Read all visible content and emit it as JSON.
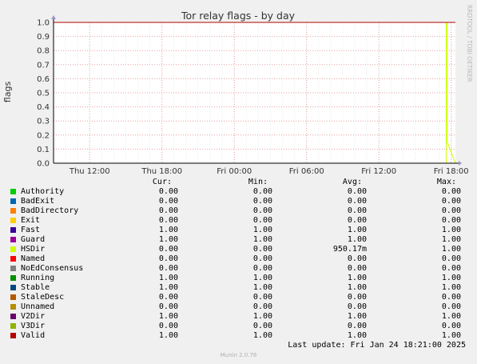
{
  "chart_data": {
    "type": "line",
    "title": "Tor relay flags - by day",
    "ylabel": "flags",
    "xlabel": "",
    "ylim": [
      0,
      1
    ],
    "y_ticks": [
      "0.0",
      "0.1",
      "0.2",
      "0.3",
      "0.4",
      "0.5",
      "0.6",
      "0.7",
      "0.8",
      "0.9",
      "1.0"
    ],
    "x_ticks": [
      "Thu 12:00",
      "Thu 18:00",
      "Fri 00:00",
      "Fri 06:00",
      "Fri 12:00",
      "Fri 18:00"
    ],
    "grid": true,
    "series": [
      {
        "name": "Authority",
        "color": "#00cc00",
        "x": [
          "Thu 09:00",
          "Fri 18:21"
        ],
        "y": [
          0,
          0
        ]
      },
      {
        "name": "BadExit",
        "color": "#0066b3",
        "x": [
          "Thu 09:00",
          "Fri 18:21"
        ],
        "y": [
          0,
          0
        ]
      },
      {
        "name": "BadDirectory",
        "color": "#ff8000",
        "x": [
          "Thu 09:00",
          "Fri 18:21"
        ],
        "y": [
          0,
          0
        ]
      },
      {
        "name": "Exit",
        "color": "#ffcc00",
        "x": [
          "Thu 09:00",
          "Fri 18:21"
        ],
        "y": [
          0,
          0
        ]
      },
      {
        "name": "Fast",
        "color": "#330099",
        "x": [
          "Thu 09:00",
          "Fri 18:21"
        ],
        "y": [
          1,
          1
        ]
      },
      {
        "name": "Guard",
        "color": "#990099",
        "x": [
          "Thu 09:00",
          "Fri 18:21"
        ],
        "y": [
          1,
          1
        ]
      },
      {
        "name": "HSDir",
        "color": "#ccff00",
        "x": [
          "Thu 09:00",
          "Fri 16:00",
          "Fri 17:35",
          "Fri 17:35",
          "Fri 17:40",
          "Fri 17:40",
          "Fri 18:21"
        ],
        "y": [
          0,
          0,
          0,
          1,
          1,
          0.15,
          0
        ]
      },
      {
        "name": "Named",
        "color": "#ff0000",
        "x": [
          "Thu 09:00",
          "Fri 18:21"
        ],
        "y": [
          0,
          0
        ]
      },
      {
        "name": "NoEdConsensus",
        "color": "#808080",
        "x": [
          "Thu 09:00",
          "Fri 18:21"
        ],
        "y": [
          0,
          0
        ]
      },
      {
        "name": "Running",
        "color": "#008f00",
        "x": [
          "Thu 09:00",
          "Fri 18:21"
        ],
        "y": [
          1,
          1
        ]
      },
      {
        "name": "Stable",
        "color": "#00487d",
        "x": [
          "Thu 09:00",
          "Fri 18:21"
        ],
        "y": [
          1,
          1
        ]
      },
      {
        "name": "StaleDesc",
        "color": "#b35a00",
        "x": [
          "Thu 09:00",
          "Fri 18:21"
        ],
        "y": [
          0,
          0
        ]
      },
      {
        "name": "Unnamed",
        "color": "#b38f00",
        "x": [
          "Thu 09:00",
          "Fri 18:21"
        ],
        "y": [
          0,
          0
        ]
      },
      {
        "name": "V2Dir",
        "color": "#6b006b",
        "x": [
          "Thu 09:00",
          "Fri 18:21"
        ],
        "y": [
          1,
          1
        ]
      },
      {
        "name": "V3Dir",
        "color": "#8fb300",
        "x": [
          "Thu 09:00",
          "Fri 18:21"
        ],
        "y": [
          0,
          0
        ]
      },
      {
        "name": "Valid",
        "color": "#b30000",
        "x": [
          "Thu 09:00",
          "Fri 18:21"
        ],
        "y": [
          1,
          1
        ]
      }
    ]
  },
  "legend": {
    "headers": {
      "cur": "Cur:",
      "min": "Min:",
      "avg": "Avg:",
      "max": "Max:"
    },
    "rows": [
      {
        "name": "Authority",
        "color": "#00cc00",
        "cur": "0.00",
        "min": "0.00",
        "avg": "0.00",
        "max": "0.00"
      },
      {
        "name": "BadExit",
        "color": "#0066b3",
        "cur": "0.00",
        "min": "0.00",
        "avg": "0.00",
        "max": "0.00"
      },
      {
        "name": "BadDirectory",
        "color": "#ff8000",
        "cur": "0.00",
        "min": "0.00",
        "avg": "0.00",
        "max": "0.00"
      },
      {
        "name": "Exit",
        "color": "#ffcc00",
        "cur": "0.00",
        "min": "0.00",
        "avg": "0.00",
        "max": "0.00"
      },
      {
        "name": "Fast",
        "color": "#330099",
        "cur": "1.00",
        "min": "1.00",
        "avg": "1.00",
        "max": "1.00"
      },
      {
        "name": "Guard",
        "color": "#990099",
        "cur": "1.00",
        "min": "1.00",
        "avg": "1.00",
        "max": "1.00"
      },
      {
        "name": "HSDir",
        "color": "#ccff00",
        "cur": "0.00",
        "min": "0.00",
        "avg": "950.17m",
        "max": "1.00"
      },
      {
        "name": "Named",
        "color": "#ff0000",
        "cur": "0.00",
        "min": "0.00",
        "avg": "0.00",
        "max": "0.00"
      },
      {
        "name": "NoEdConsensus",
        "color": "#808080",
        "cur": "0.00",
        "min": "0.00",
        "avg": "0.00",
        "max": "0.00"
      },
      {
        "name": "Running",
        "color": "#008f00",
        "cur": "1.00",
        "min": "1.00",
        "avg": "1.00",
        "max": "1.00"
      },
      {
        "name": "Stable",
        "color": "#00487d",
        "cur": "1.00",
        "min": "1.00",
        "avg": "1.00",
        "max": "1.00"
      },
      {
        "name": "StaleDesc",
        "color": "#b35a00",
        "cur": "0.00",
        "min": "0.00",
        "avg": "0.00",
        "max": "0.00"
      },
      {
        "name": "Unnamed",
        "color": "#b38f00",
        "cur": "0.00",
        "min": "0.00",
        "avg": "0.00",
        "max": "0.00"
      },
      {
        "name": "V2Dir",
        "color": "#6b006b",
        "cur": "1.00",
        "min": "1.00",
        "avg": "1.00",
        "max": "1.00"
      },
      {
        "name": "V3Dir",
        "color": "#8fb300",
        "cur": "0.00",
        "min": "0.00",
        "avg": "0.00",
        "max": "0.00"
      },
      {
        "name": "Valid",
        "color": "#b30000",
        "cur": "1.00",
        "min": "1.00",
        "avg": "1.00",
        "max": "1.00"
      }
    ]
  },
  "last_update": "Last update: Fri Jan 24 18:21:00 2025",
  "watermark": "RRDTOOL / TOBI OETIKER",
  "footer": "Munin 2.0.76",
  "colors": {
    "background": "#f0f0f0",
    "plot_bg": "#ffffff",
    "grid": "#e6a0a0",
    "axis": "#000000"
  }
}
